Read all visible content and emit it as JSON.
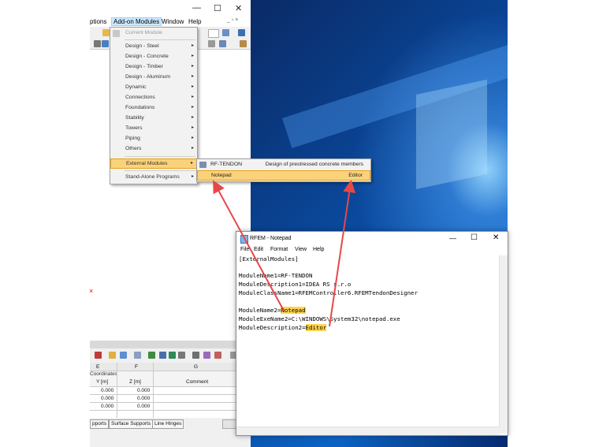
{
  "rfem": {
    "menubar": {
      "options": "ptions",
      "addon": "Add-on Modules",
      "window": "Window",
      "help": "Help"
    },
    "window_controls": {
      "min": "—",
      "max": "☐",
      "close": "✕"
    },
    "sub_controls": "_ ▫ ×"
  },
  "menu": {
    "current_module": "Current Module",
    "items": [
      "Design - Steel",
      "Design - Concrete",
      "Design - Timber",
      "Design - Aluminum",
      "Dynamic",
      "Connections",
      "Foundations",
      "Stability",
      "Towers",
      "Piping",
      "Others"
    ],
    "external": "External Modules",
    "standalone": "Stand-Alone Programs",
    "arrow": "▸"
  },
  "submenu": {
    "items": [
      {
        "name": "RF-TENDON",
        "desc": "Design of prestressed concrete members"
      },
      {
        "name": "Notepad",
        "desc": "Editor"
      }
    ]
  },
  "table": {
    "cols": [
      "E",
      "F",
      "G"
    ],
    "group": "Coordinates",
    "headers": [
      "Y [m]",
      "Z [m]",
      "Comment"
    ],
    "rows": [
      [
        "0.000",
        "0.000"
      ],
      [
        "0.000",
        "0.000"
      ],
      [
        "0.000",
        "0.000"
      ]
    ],
    "tabs": [
      "pports",
      "Surface Supports",
      "Line Hinges"
    ],
    "marker": "×"
  },
  "notepad": {
    "title": "RFEM - Notepad",
    "controls": {
      "min": "—",
      "max": "☐",
      "close": "✕"
    },
    "menu": [
      "File",
      "Edit",
      "Format",
      "View",
      "Help"
    ],
    "lines": {
      "l1": "[ExternalModules]",
      "l2": "ModuleName1=RF-TENDON",
      "l3": "ModuleDescription1=IDEA RS s.r.o",
      "l4": "ModuleClassName1=RFEMController6.RFEMTendonDesigner",
      "l5a": "ModuleName2=",
      "l5b": "Notepad",
      "l6": "ModuleExeName2=C:\\WINDOWS\\System32\\notepad.exe",
      "l7a": "ModuleDescription2=",
      "l7b": "Editor"
    }
  },
  "colors": {
    "highlight": "#fbd27a",
    "arrow": "#e8474a",
    "text_highlight": "#ffd54f",
    "desktop": "#0a4fa8"
  }
}
